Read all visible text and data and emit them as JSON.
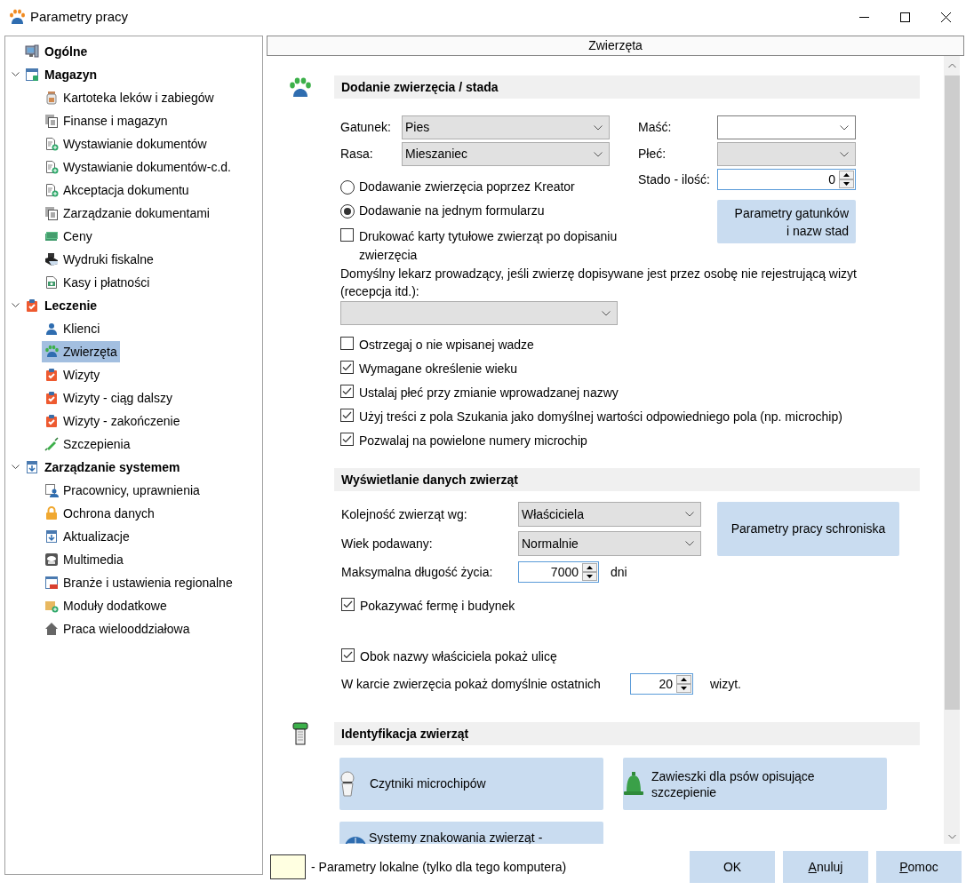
{
  "window": {
    "title": "Parametry pracy"
  },
  "sidebar": {
    "items": [
      {
        "label": "Ogólne",
        "selected": false
      },
      {
        "label": "Magazyn",
        "selected": false,
        "expanded": true,
        "children": [
          {
            "label": "Kartoteka leków i zabiegów",
            "selected": false
          },
          {
            "label": "Finanse i magazyn",
            "selected": false
          },
          {
            "label": "Wystawianie dokumentów",
            "selected": false
          },
          {
            "label": "Wystawianie dokumentów-c.d.",
            "selected": false
          },
          {
            "label": "Akceptacja dokumentu",
            "selected": false
          },
          {
            "label": "Zarządzanie dokumentami",
            "selected": false
          },
          {
            "label": "Ceny",
            "selected": false
          },
          {
            "label": "Wydruki fiskalne",
            "selected": false
          },
          {
            "label": "Kasy i płatności",
            "selected": false
          }
        ]
      },
      {
        "label": "Leczenie",
        "selected": false,
        "expanded": true,
        "children": [
          {
            "label": "Klienci",
            "selected": false
          },
          {
            "label": "Zwierzęta",
            "selected": true
          },
          {
            "label": "Wizyty",
            "selected": false
          },
          {
            "label": "Wizyty - ciąg dalszy",
            "selected": false
          },
          {
            "label": "Wizyty - zakończenie",
            "selected": false
          },
          {
            "label": "Szczepienia",
            "selected": false
          }
        ]
      },
      {
        "label": "Zarządzanie systemem",
        "selected": false,
        "expanded": true,
        "children": [
          {
            "label": "Pracownicy, uprawnienia",
            "selected": false
          },
          {
            "label": "Ochrona danych",
            "selected": false
          },
          {
            "label": "Aktualizacje",
            "selected": false
          },
          {
            "label": "Multimedia",
            "selected": false
          },
          {
            "label": "Branże i ustawienia regionalne",
            "selected": false
          },
          {
            "label": "Moduły dodatkowe",
            "selected": false
          },
          {
            "label": "Praca wielooddziałowa",
            "selected": false
          }
        ]
      }
    ]
  },
  "panel": {
    "title": "Zwierzęta"
  },
  "add_section": {
    "title": "Dodanie zwierzęcia / stada",
    "species": {
      "label": "Gatunek:",
      "value": "Pies",
      "kind": "dropdown"
    },
    "breed": {
      "label": "Rasa:",
      "value": "Mieszaniec",
      "kind": "dropdown"
    },
    "radios": [
      {
        "label": "Dodawanie zwierzęcia poprzez Kreator",
        "selected": false
      },
      {
        "label": "Dodawanie na jednym formularzu",
        "selected": true
      }
    ],
    "print_cards": {
      "label": "Drukować karty tytułowe zwierząt po dopisaniu zwierzęcia",
      "checked": false
    },
    "coat": {
      "label": "Maść:",
      "kind": "editable"
    },
    "sex": {
      "label": "Płeć:",
      "kind": "dropdown"
    },
    "herd": {
      "label": "Stado - ilość:",
      "value": "0"
    },
    "species_button": "Parametry gatunków i nazw stad",
    "doctor": {
      "label": "Domyślny lekarz prowadzący, jeśli  zwierzę dopisywane jest przez osobę nie rejestrującą wizyt (recepcja itd.):",
      "kind": "dropdown"
    },
    "checkboxes": [
      {
        "label": "Ostrzegaj o nie wpisanej wadze",
        "checked": false
      },
      {
        "label": "Wymagane określenie wieku",
        "checked": true
      },
      {
        "label": "Ustalaj płeć przy zmianie wprowadzanej nazwy",
        "checked": true
      },
      {
        "label": "Użyj treści z pola Szukania jako domyślnej wartości odpowiedniego pola  (np. microchip)",
        "checked": true
      },
      {
        "label": "Pozwalaj na powielone numery microchip",
        "checked": true
      }
    ]
  },
  "display_section": {
    "title": "Wyświetlanie danych zwierząt",
    "order": {
      "label": "Kolejność zwierząt wg:",
      "value": "Właściciela",
      "kind": "dropdown"
    },
    "age": {
      "label": "Wiek podawany:",
      "value": "Normalnie",
      "kind": "dropdown"
    },
    "lifespan": {
      "label": "Maksymalna długość życia:",
      "value": "7000",
      "unit": "dni"
    },
    "shelter_button": "Parametry pracy schroniska",
    "farm": {
      "label": "Pokazywać fermę i budynek",
      "checked": true
    },
    "street": {
      "label": "Obok nazwy właściciela pokaż ulicę",
      "checked": true
    },
    "visits": {
      "label": "W karcie zwierzęcia pokaż domyślnie ostatnich",
      "value": "20",
      "unit": "wizyt."
    }
  },
  "id_section": {
    "title": "Identyfikacja zwierząt",
    "buttons": [
      {
        "label": "Czytniki microchipów"
      },
      {
        "label": "Zawieszki dla psów opisujące szczepienie"
      },
      {
        "label": "Systemy znakowania zwierząt -"
      }
    ]
  },
  "footer": {
    "legend": "- Parametry lokalne (tylko dla tego komputera)",
    "buttons": [
      {
        "label": "OK",
        "accelerator": false
      },
      {
        "label": "Anuluj",
        "accelerator": true
      },
      {
        "label": "Pomoc",
        "accelerator": true
      }
    ]
  }
}
